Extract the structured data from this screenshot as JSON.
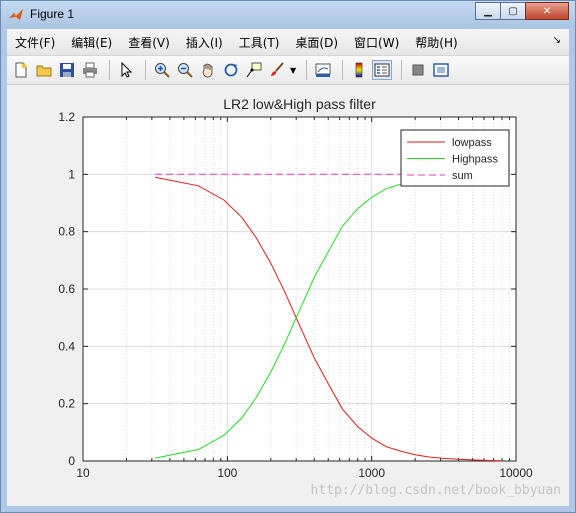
{
  "window": {
    "title": "Figure 1",
    "minimize_icon": "minimize-icon",
    "maximize_icon": "maximize-icon",
    "close_icon": "close-icon"
  },
  "menubar": {
    "items": [
      {
        "label": "文件(F)"
      },
      {
        "label": "编辑(E)"
      },
      {
        "label": "查看(V)"
      },
      {
        "label": "插入(I)"
      },
      {
        "label": "工具(T)"
      },
      {
        "label": "桌面(D)"
      },
      {
        "label": "窗口(W)"
      },
      {
        "label": "帮助(H)"
      }
    ],
    "overflow_icon": "chevron-icon"
  },
  "toolbar": {
    "buttons": [
      "new-figure",
      "open-file",
      "save",
      "print",
      "pointer",
      "zoom-in",
      "zoom-out",
      "pan",
      "rotate-3d",
      "data-cursor",
      "brush",
      "link",
      "colorbar",
      "legend",
      "hide-plot-tools",
      "show-plot-tools"
    ]
  },
  "watermark": "http://blog.csdn.net/book_bbyuan",
  "chart_data": {
    "type": "line",
    "title": "LR2 low&High pass filter",
    "xlabel": "",
    "ylabel": "",
    "xscale": "log",
    "xlim": [
      10,
      10000
    ],
    "ylim": [
      0,
      1.2
    ],
    "xticks": [
      10,
      100,
      1000,
      10000
    ],
    "xtick_labels": [
      "10",
      "100",
      "1000",
      "10000"
    ],
    "yticks": [
      0,
      0.2,
      0.4,
      0.6,
      0.8,
      1,
      1.2
    ],
    "ytick_labels": [
      "0",
      "0.2",
      "0.4",
      "0.6",
      "0.8",
      "1",
      "1.2"
    ],
    "grid": true,
    "legend_placement": "top-right",
    "x": [
      31.6,
      63,
      95,
      126,
      158,
      200,
      250,
      300,
      400,
      500,
      630,
      800,
      1000,
      1260,
      1580,
      2000,
      2500,
      3160,
      4000,
      5000,
      6300,
      8000
    ],
    "series": [
      {
        "name": "lowpass",
        "color": "#e31a1c",
        "style": "solid",
        "values": [
          0.99,
          0.96,
          0.91,
          0.85,
          0.78,
          0.69,
          0.59,
          0.5,
          0.36,
          0.27,
          0.18,
          0.12,
          0.08,
          0.05,
          0.035,
          0.022,
          0.014,
          0.009,
          0.006,
          0.004,
          0.002,
          0.001
        ]
      },
      {
        "name": "Highpass",
        "color": "#22dd22",
        "style": "solid",
        "values": [
          0.01,
          0.04,
          0.09,
          0.15,
          0.22,
          0.31,
          0.41,
          0.5,
          0.64,
          0.73,
          0.82,
          0.88,
          0.92,
          0.95,
          0.965,
          0.978,
          0.986,
          0.991,
          0.994,
          0.996,
          0.998,
          0.999
        ]
      },
      {
        "name": "sum",
        "color": "#ff33cc",
        "style": "dashed",
        "values": [
          1,
          1,
          1,
          1,
          1,
          1,
          1,
          1,
          1,
          1,
          1,
          1,
          1,
          1,
          1,
          1,
          1,
          1,
          1,
          1,
          1,
          1
        ]
      }
    ]
  }
}
